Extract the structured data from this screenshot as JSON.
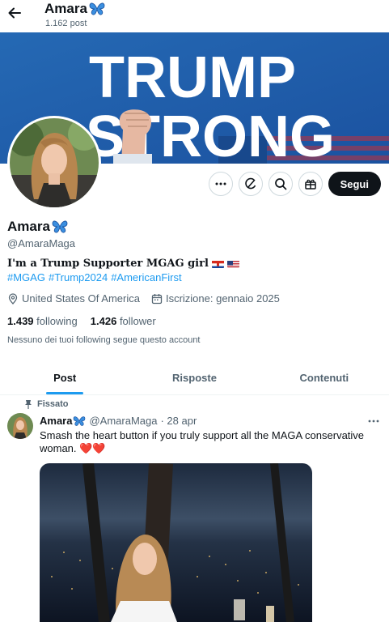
{
  "header": {
    "name": "Amara",
    "post_count": "1.162 post"
  },
  "banner": {
    "line1": "TRUMP",
    "line2": "STRONG"
  },
  "actions": {
    "follow_label": "Segui"
  },
  "profile": {
    "name": "Amara",
    "handle": "@AmaraMaga",
    "bio": "I'm a Trump Supporter MGAG girl",
    "hashtags": [
      "#MGAG",
      "#Trump2024",
      "#AmericanFirst"
    ],
    "location": "United States Of America",
    "joined": "Iscrizione: gennaio 2025",
    "following_count": "1.439",
    "following_label": "following",
    "followers_count": "1.426",
    "followers_label": "follower",
    "note": "Nessuno dei tuoi following segue questo account"
  },
  "tabs": [
    {
      "label": "Post",
      "active": true
    },
    {
      "label": "Risposte",
      "active": false
    },
    {
      "label": "Contenuti",
      "active": false
    }
  ],
  "post": {
    "pinned_label": "Fissato",
    "author": "Amara",
    "handle": "@AmaraMaga",
    "date": "· 28 apr",
    "text": "Smash the heart button if you truly support all the MAGA conservative woman.",
    "emoji": "❤️❤️"
  },
  "colors": {
    "accent": "#1d9bf0",
    "banner_blue": "#1e5ea8",
    "follow_button": "#0f1419"
  }
}
